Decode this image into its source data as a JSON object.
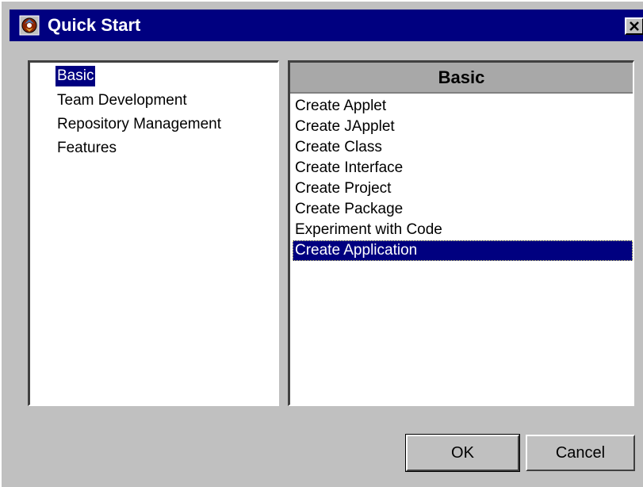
{
  "window": {
    "title": "Quick Start",
    "close_label": "✕"
  },
  "categories": [
    {
      "label": "Basic",
      "selected": true
    },
    {
      "label": "Team Development",
      "selected": false
    },
    {
      "label": "Repository Management",
      "selected": false
    },
    {
      "label": "Features",
      "selected": false
    }
  ],
  "detail": {
    "header": "Basic",
    "items": [
      {
        "label": "Create Applet",
        "selected": false
      },
      {
        "label": "Create JApplet",
        "selected": false
      },
      {
        "label": "Create Class",
        "selected": false
      },
      {
        "label": "Create Interface",
        "selected": false
      },
      {
        "label": "Create Project",
        "selected": false
      },
      {
        "label": "Create Package",
        "selected": false
      },
      {
        "label": "Experiment with Code",
        "selected": false
      },
      {
        "label": "Create Application",
        "selected": true
      }
    ]
  },
  "buttons": {
    "ok_label": "OK",
    "cancel_label": "Cancel"
  },
  "colors": {
    "titlebar": "#000080",
    "selection": "#000080",
    "face": "#c0c0c0"
  },
  "icons": {
    "app": "java-app-icon",
    "close": "close-icon"
  }
}
